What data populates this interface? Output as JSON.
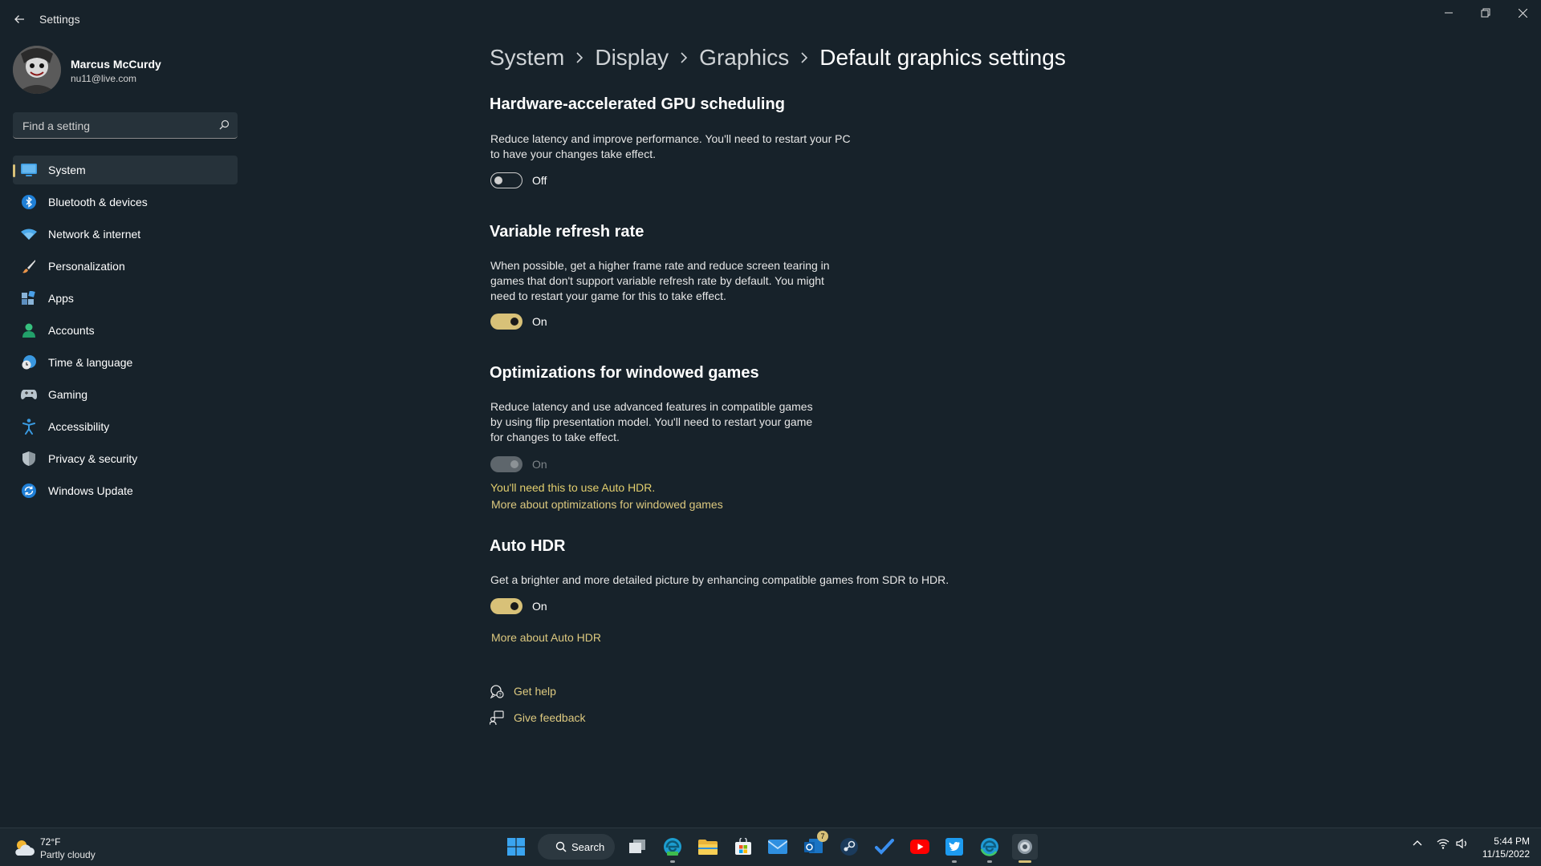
{
  "app": {
    "title": "Settings"
  },
  "profile": {
    "name": "Marcus McCurdy",
    "email": "nu11@live.com"
  },
  "search": {
    "placeholder": "Find a setting"
  },
  "sidebar": {
    "items": [
      {
        "label": "System",
        "icon": "system-icon",
        "active": true
      },
      {
        "label": "Bluetooth & devices",
        "icon": "bluetooth-icon"
      },
      {
        "label": "Network & internet",
        "icon": "wifi-icon"
      },
      {
        "label": "Personalization",
        "icon": "brush-icon"
      },
      {
        "label": "Apps",
        "icon": "apps-icon"
      },
      {
        "label": "Accounts",
        "icon": "person-icon"
      },
      {
        "label": "Time & language",
        "icon": "globe-clock-icon"
      },
      {
        "label": "Gaming",
        "icon": "gamepad-icon"
      },
      {
        "label": "Accessibility",
        "icon": "accessibility-icon"
      },
      {
        "label": "Privacy & security",
        "icon": "shield-icon"
      },
      {
        "label": "Windows Update",
        "icon": "update-icon"
      }
    ]
  },
  "breadcrumb": [
    "System",
    "Display",
    "Graphics",
    "Default graphics settings"
  ],
  "sections": {
    "gpu": {
      "title": "Hardware-accelerated GPU scheduling",
      "desc": "Reduce latency and improve performance. You'll need to restart your PC to have your changes take effect.",
      "toggle_state": "Off"
    },
    "vrr": {
      "title": "Variable refresh rate",
      "desc": "When possible, get a higher frame rate and reduce screen tearing in games that don't support variable refresh rate by default. You might need to restart your game for this to take effect.",
      "toggle_state": "On"
    },
    "windowed": {
      "title": "Optimizations for windowed games",
      "desc": "Reduce latency and use advanced features in compatible games by using flip presentation model. You'll need to restart your game for changes to take effect.",
      "toggle_state": "On",
      "note": "You'll need this to use Auto HDR.",
      "link": "More about optimizations for windowed games"
    },
    "autohdr": {
      "title": "Auto HDR",
      "desc": "Get a brighter and more detailed picture by enhancing compatible games from SDR to HDR.",
      "toggle_state": "On",
      "link": "More about Auto HDR"
    }
  },
  "help": {
    "get_help": "Get help",
    "give_feedback": "Give feedback"
  },
  "taskbar": {
    "weather": {
      "temp": "72°F",
      "condition": "Partly cloudy"
    },
    "search_label": "Search",
    "mail_badge": "7",
    "time": "5:44 PM",
    "date": "11/15/2022"
  },
  "colors": {
    "accent": "#d8c178",
    "background": "#17222a",
    "link": "#ddc97f"
  }
}
